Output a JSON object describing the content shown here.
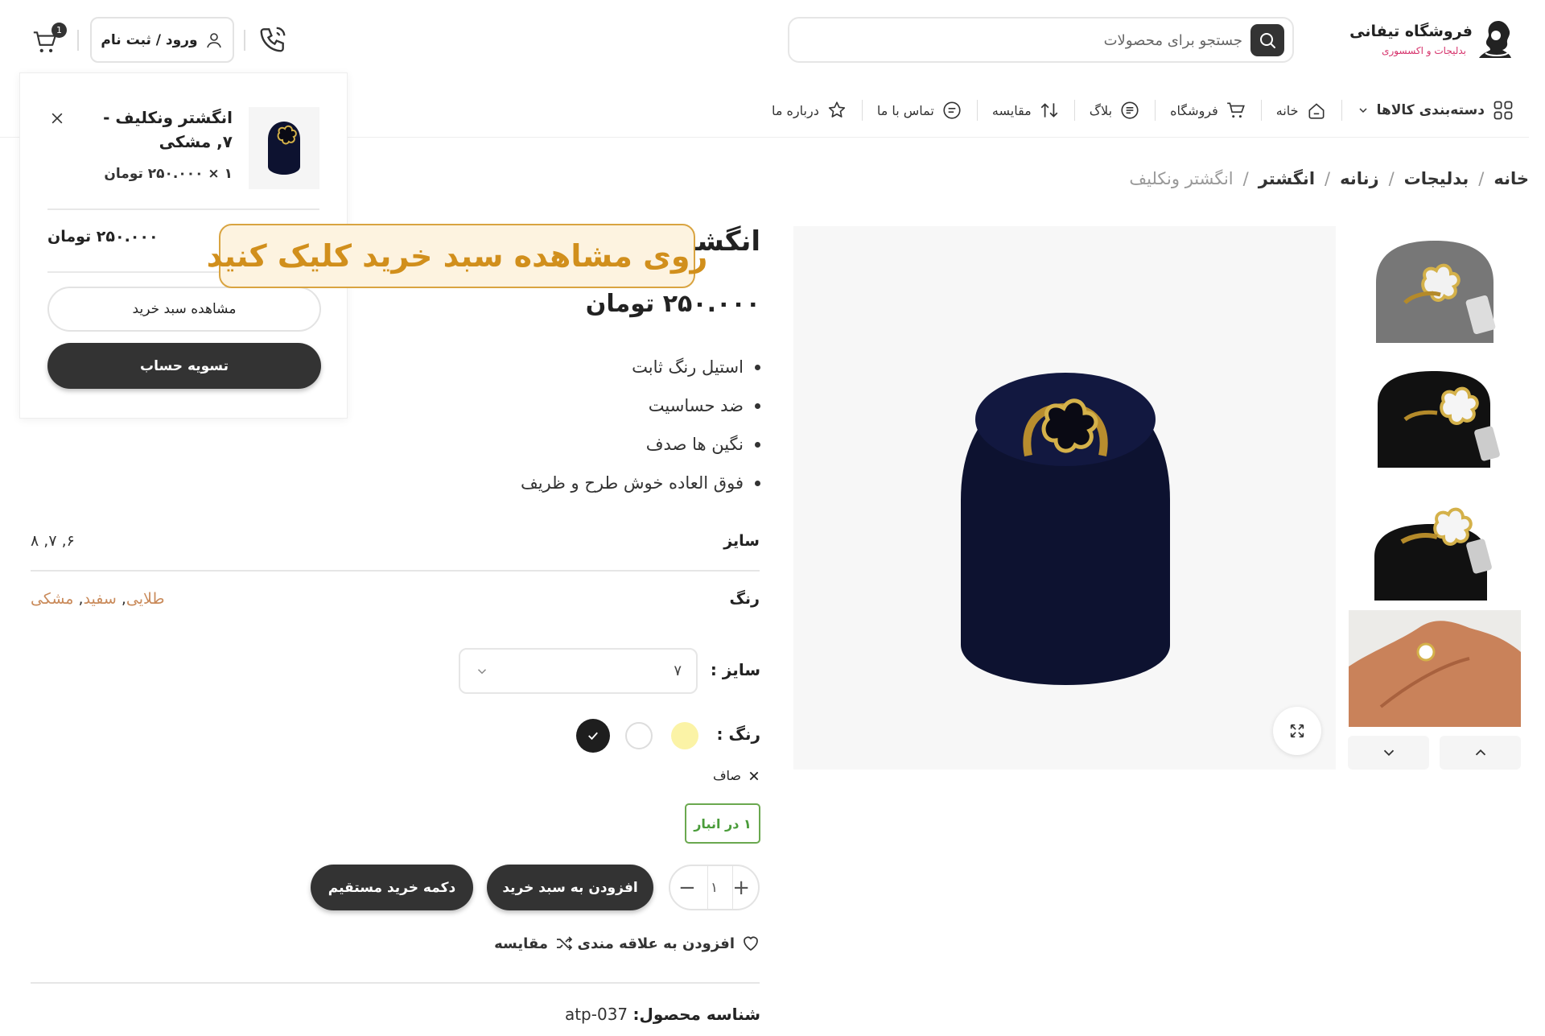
{
  "header": {
    "logo_title": "فروشگاه تیفانی",
    "logo_subtitle": "بدلیجات و اکسسوری",
    "search_placeholder": "جستجو برای محصولات",
    "login_label": "ورود / ثبت نام",
    "cart_count": "1"
  },
  "nav": {
    "categories_label": "دسته‌بندی کالاها",
    "items": [
      {
        "label": "خانه",
        "icon": "home-icon"
      },
      {
        "label": "فروشگاه",
        "icon": "cart-icon"
      },
      {
        "label": "بلاگ",
        "icon": "document-icon"
      },
      {
        "label": "مقایسه",
        "icon": "compare-arrows-icon"
      },
      {
        "label": "تماس با ما",
        "icon": "chat-icon"
      },
      {
        "label": "درباره ما",
        "icon": "star-icon"
      }
    ]
  },
  "breadcrumb": {
    "items": [
      "خانه",
      "بدلیجات",
      "زنانه",
      "انگشتر"
    ],
    "current": "انگشتر ونکلیف"
  },
  "product": {
    "title": "انگشتر ونکلیف",
    "price": "۲۵۰.۰۰۰ تومان",
    "features": [
      "استیل رنگ ثابت",
      "ضد حساسیت",
      "نگین ها صدف",
      "فوق العاده خوش طرح و ظریف"
    ],
    "attributes": {
      "size_label": "سایز",
      "size_value": "۶, ۷, ۸",
      "color_label": "رنگ",
      "color_values": [
        "طلایی",
        "سفید",
        "مشکی"
      ]
    },
    "size_select_label": "سایز :",
    "size_selected": "۷",
    "color_select_label": "رنگ :",
    "swatches": [
      "#fbf3a6",
      "#ffffff",
      "#222222"
    ],
    "clear_label": "صاف",
    "stock": "۱ در انبار",
    "quantity": "۱",
    "add_to_cart": "افزودن به سبد خرید",
    "buy_now": "دکمه خرید مستقیم",
    "wishlist": "افزودن به علاقه مندی",
    "compare": "مقایسه",
    "sku_label": "شناسه محصول:",
    "sku_value": "atp-037"
  },
  "mini_cart": {
    "item_name": "انگشتر ونکلیف - ۷, مشکی",
    "item_qty_price": "۱ × ۲۵۰.۰۰۰ تومان",
    "subtotal": "۲۵۰.۰۰۰ تومان",
    "view_cart": "مشاهده سبد خرید",
    "checkout": "تسویه حساب"
  },
  "tooltip": "روی مشاهده سبد خرید کلیک کنید",
  "colors": {
    "accent_dark": "#333333",
    "tooltip_text": "#d18f1c",
    "tooltip_border": "#d9a441",
    "stock_green": "#4a9c3a",
    "attr_link": "#c98a5a"
  }
}
